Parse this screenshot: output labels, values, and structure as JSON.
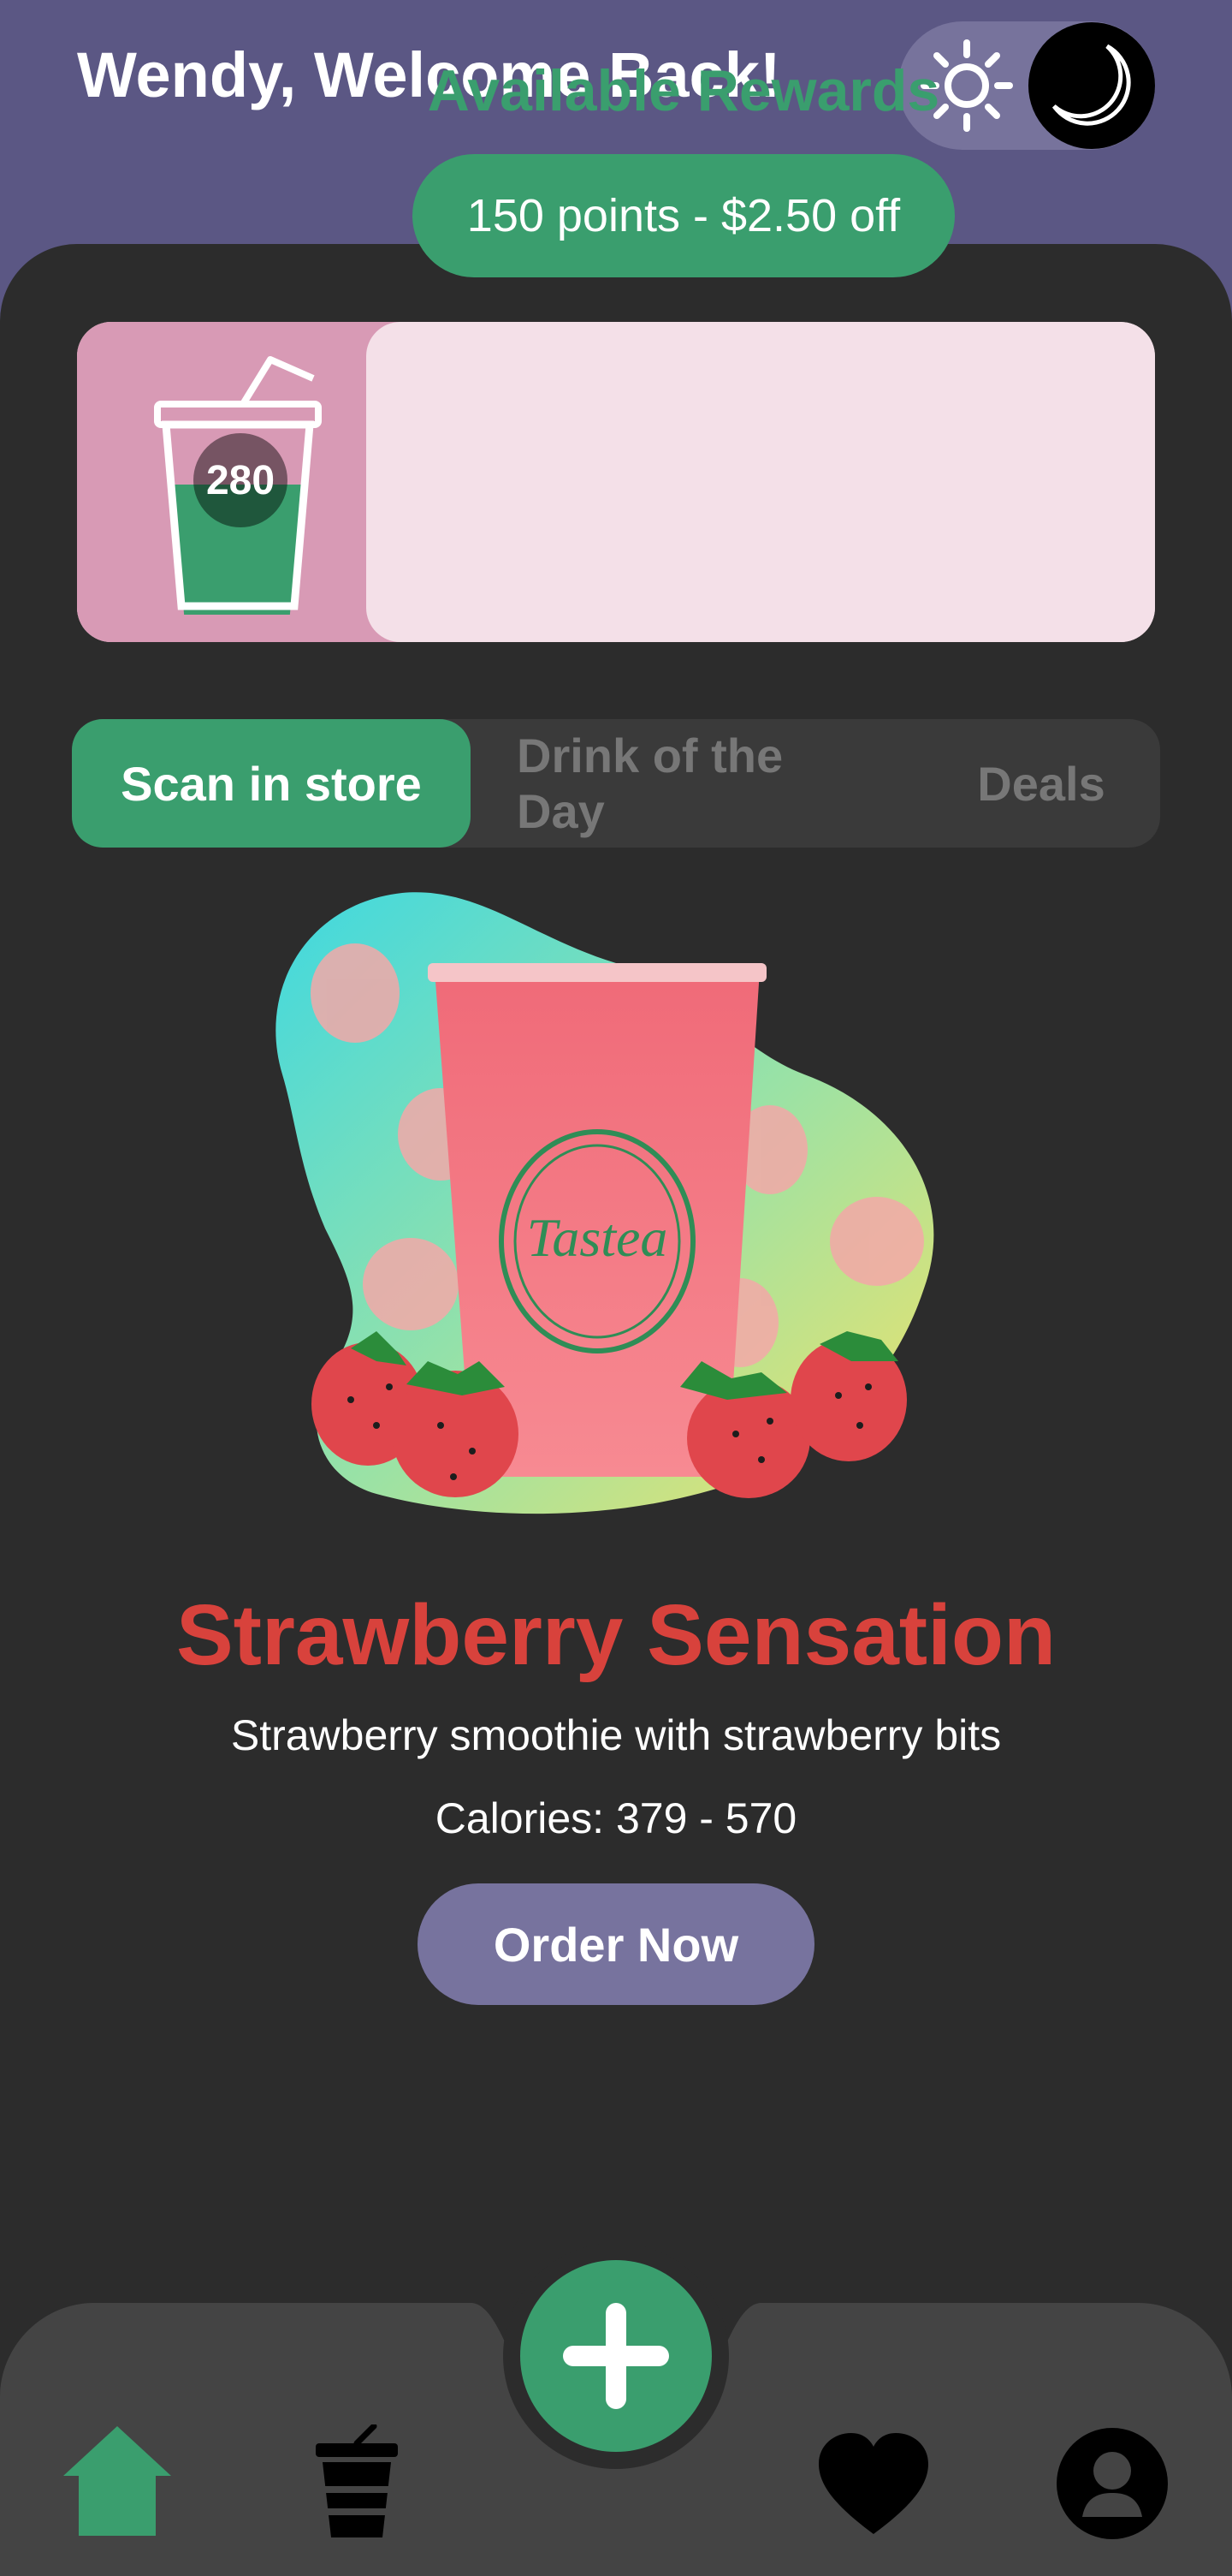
{
  "header": {
    "greeting": "Wendy, Welcome Back!",
    "theme_toggle": {
      "options": [
        "sun-icon",
        "moon-icon"
      ],
      "selected": "moon-icon"
    }
  },
  "rewards": {
    "points": "280",
    "title": "Available Rewards",
    "offer": "150 points - $2.50 off",
    "cup_fill_fraction": 0.5
  },
  "tabs": [
    {
      "label": "Scan in store",
      "active": true
    },
    {
      "label": "Drink of the Day",
      "active": false
    },
    {
      "label": "Deals",
      "active": false
    }
  ],
  "featured": {
    "name": "Strawberry Sensation",
    "description": "Strawberry smoothie with strawberry bits",
    "calories": "Calories: 379 - 570",
    "order_label": "Order Now",
    "cup_logo": "Tastea"
  },
  "nav": {
    "items": [
      "home-icon",
      "drink-icon",
      "add-icon",
      "heart-icon",
      "profile-icon"
    ],
    "active": "home-icon"
  },
  "colors": {
    "header_bg": "#5b5784",
    "content_bg": "#2c2c2c",
    "accent_green": "#3a9e6e",
    "drink_name_red": "#d8423c",
    "order_button": "#77739e",
    "rewards_pink": "#d89ab5",
    "rewards_light": "#f4e0e8"
  }
}
